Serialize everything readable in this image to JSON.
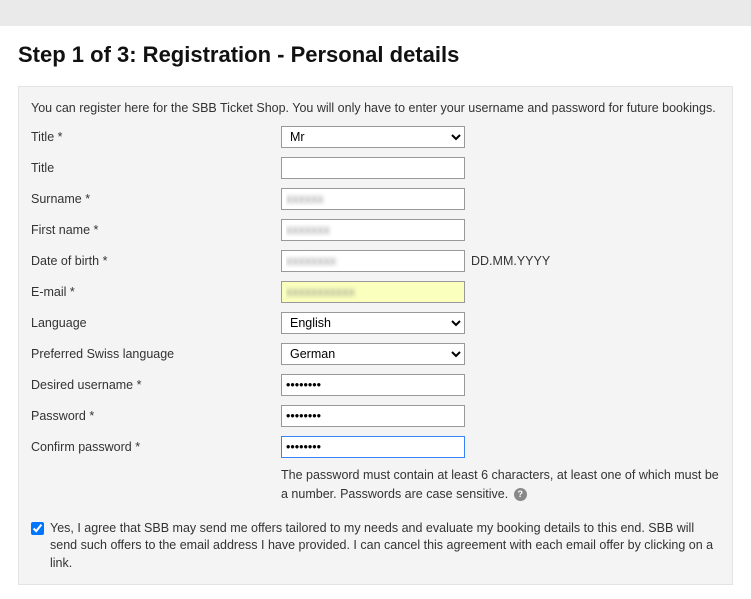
{
  "heading": "Step 1 of 3: Registration - Personal details",
  "intro": "You can register here for the SBB Ticket Shop. You will only have to enter your username and password for future bookings.",
  "labels": {
    "title_req": "Title *",
    "title_opt": "Title",
    "surname": "Surname *",
    "first_name": "First name *",
    "dob": "Date of birth  *",
    "email": "E-mail *",
    "language": "Language",
    "pref_swiss": "Preferred Swiss language",
    "username": "Desired username *",
    "password": "Password *",
    "confirm": "Confirm password *"
  },
  "values": {
    "title_select": "Mr",
    "title_opt": "",
    "surname": "",
    "first_name": "",
    "dob": "",
    "email": "",
    "language": "English",
    "pref_swiss": "German",
    "username": "••••••••",
    "password": "••••••••",
    "confirm": "••••••••"
  },
  "hints": {
    "dob_format": "DD.MM.YYYY"
  },
  "password_help": "The password must contain at least 6 characters, at least one of which must be a number. Passwords are case sensitive.",
  "consent": "Yes, I agree that SBB may send me offers tailored to my needs and evaluate my booking details to this end. SBB will send such offers to the email address I have provided. I can cancel this agreement with each email offer by clicking on a link.",
  "consent_checked": true
}
